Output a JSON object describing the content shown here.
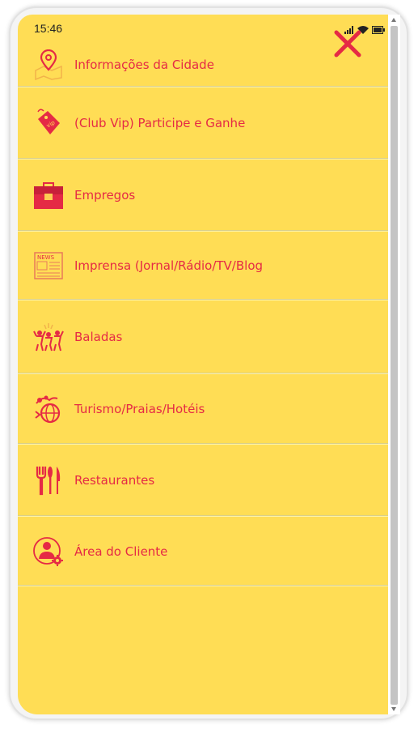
{
  "status_bar": {
    "time": "15:46"
  },
  "close": {
    "icon": "close-x-icon",
    "color": "#e52a45"
  },
  "theme": {
    "background": "#ffdd55",
    "accent": "#e52a45"
  },
  "menu": {
    "items": [
      {
        "label": "Informações da Cidade",
        "icon": "map-pin-icon"
      },
      {
        "label": "(Club Vip) Participe e Ganhe",
        "icon": "vip-tag-icon"
      },
      {
        "label": "Empregos",
        "icon": "briefcase-icon"
      },
      {
        "label": "Imprensa (Jornal/Rádio/TV/Blog",
        "icon": "newspaper-icon"
      },
      {
        "label": "Baladas",
        "icon": "party-people-icon"
      },
      {
        "label": "Turismo/Praias/Hotéis",
        "icon": "tourism-globe-icon"
      },
      {
        "label": "Restaurantes",
        "icon": "cutlery-icon"
      },
      {
        "label": "Área do Cliente",
        "icon": "client-user-gear-icon"
      }
    ]
  }
}
